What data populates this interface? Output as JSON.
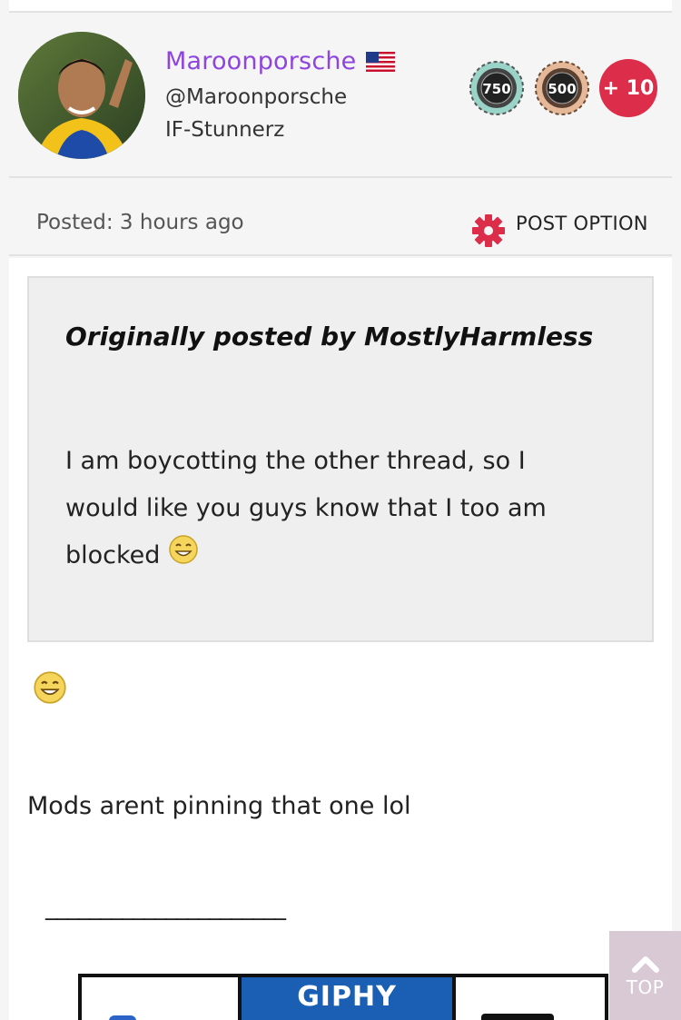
{
  "user": {
    "name": "Maroonporsche",
    "handle": "@Maroonporsche",
    "group": "IF-Stunnerz",
    "flag_icon": "us-flag-icon",
    "badges": [
      {
        "label": "750",
        "icon": "badge-750-icon"
      },
      {
        "label": "500",
        "icon": "badge-500-icon"
      }
    ],
    "more_badges_label": "+ 10"
  },
  "post": {
    "posted_label": "Posted: 3 hours ago",
    "option_label": "POST OPTION",
    "option_icon": "gear-icon",
    "quote": {
      "author_line": "Originally posted by MostlyHarmless",
      "text": "I am boycotting the other thread, so I would like you guys know that I too am blocked"
    },
    "body_text": "Mods arent pinning that one lol",
    "signature_line": "______________________",
    "giphy_label": "GIPHY"
  },
  "nav": {
    "top_label": "TOP"
  },
  "colors": {
    "username": "#8e44e0",
    "accent": "#dc2d4a",
    "top_button": "#d8c9d4"
  }
}
